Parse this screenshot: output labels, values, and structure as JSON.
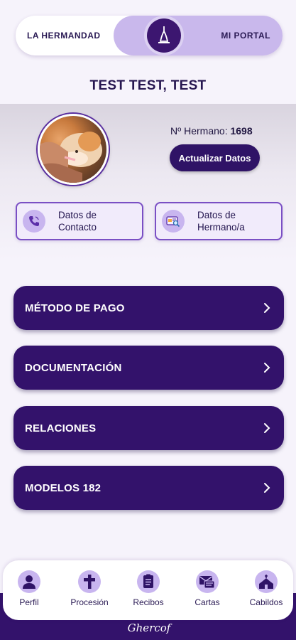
{
  "toggle": {
    "left_label": "LA HERMANDAD",
    "right_label": "MI PORTAL",
    "selected": "MI PORTAL",
    "knob_icon": "candle-icon"
  },
  "profile": {
    "name": "TEST TEST, TEST",
    "member_number_label": "Nº Hermano:",
    "member_number_value": "1698",
    "update_button": "Actualizar Datos"
  },
  "info_cards": [
    {
      "label": "Datos de\nContacto",
      "icon": "phone-icon"
    },
    {
      "label": "Datos de\nHermano/a",
      "icon": "id-card-search-icon"
    }
  ],
  "menu": [
    {
      "label": "MÉTODO DE PAGO"
    },
    {
      "label": "DOCUMENTACIÓN"
    },
    {
      "label": "RELACIONES"
    },
    {
      "label": "MODELOS 182"
    }
  ],
  "nav": [
    {
      "label": "Perfil",
      "icon": "person-icon"
    },
    {
      "label": "Procesión",
      "icon": "cross-icon"
    },
    {
      "label": "Recibos",
      "icon": "receipt-icon"
    },
    {
      "label": "Cartas",
      "icon": "letters-icon"
    },
    {
      "label": "Cabildos",
      "icon": "church-icon"
    }
  ],
  "brand": "Ghercof",
  "colors": {
    "primary": "#33126b",
    "accent_light": "#c8b5ef",
    "background": "#f6f3fb"
  }
}
